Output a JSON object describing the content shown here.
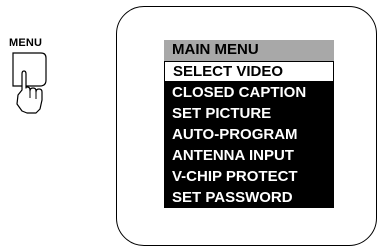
{
  "remote": {
    "button_label": "MENU",
    "icon": "hand-pressing-button-icon"
  },
  "menu": {
    "title": "MAIN MENU",
    "items": [
      {
        "label": "SELECT VIDEO",
        "selected": true
      },
      {
        "label": "CLOSED CAPTION",
        "selected": false
      },
      {
        "label": "SET PICTURE",
        "selected": false
      },
      {
        "label": "AUTO-PROGRAM",
        "selected": false
      },
      {
        "label": "ANTENNA INPUT",
        "selected": false
      },
      {
        "label": "V-CHIP PROTECT",
        "selected": false
      },
      {
        "label": "SET PASSWORD",
        "selected": false
      }
    ]
  },
  "colors": {
    "header_bg": "#a8a8a8",
    "menu_bg": "#000000",
    "selected_bg": "#ffffff"
  }
}
